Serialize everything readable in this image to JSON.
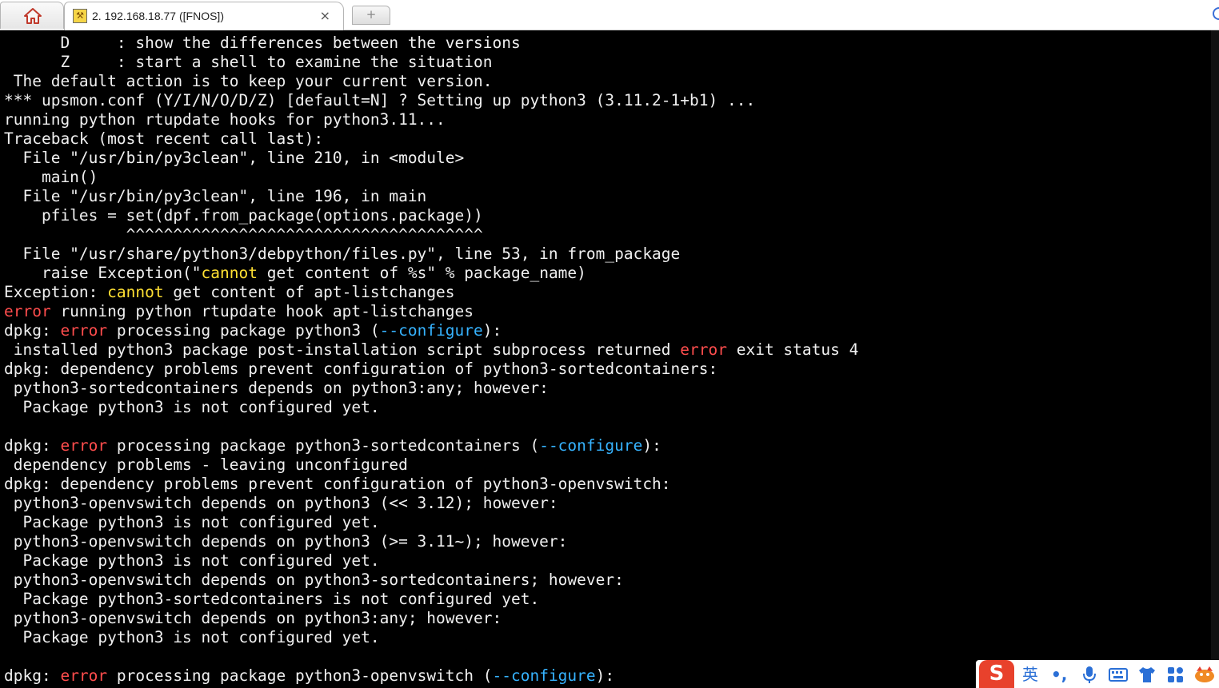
{
  "window": {
    "home_tab_icon": "home-icon",
    "session_tab": {
      "icon": "terminal-key-icon",
      "title": "2. 192.168.18.77 ([FNOS])",
      "close_glyph": "×"
    },
    "new_tab_glyph": "+"
  },
  "colors": {
    "background": "#000000",
    "text": "#f0f0f0",
    "error": "#ff4d4d",
    "configure": "#36b3ff",
    "cannot": "#ffe033"
  },
  "terminal": {
    "lines": [
      [
        {
          "t": "      D     : show the differences between the versions"
        }
      ],
      [
        {
          "t": "      Z     : start a shell to examine the situation"
        }
      ],
      [
        {
          "t": " The default action is to keep your current version."
        }
      ],
      [
        {
          "t": "*** upsmon.conf (Y/I/N/O/D/Z) [default=N] ? Setting up python3 (3.11.2-1+b1) ..."
        }
      ],
      [
        {
          "t": "running python rtupdate hooks for python3.11..."
        }
      ],
      [
        {
          "t": "Traceback (most recent call last):"
        }
      ],
      [
        {
          "t": "  File \"/usr/bin/py3clean\", line 210, in <module>"
        }
      ],
      [
        {
          "t": "    main()"
        }
      ],
      [
        {
          "t": "  File \"/usr/bin/py3clean\", line 196, in main"
        }
      ],
      [
        {
          "t": "    pfiles = set(dpf.from_package(options.package))"
        }
      ],
      [
        {
          "t": "             ^^^^^^^^^^^^^^^^^^^^^^^^^^^^^^^^^^^^^^"
        }
      ],
      [
        {
          "t": "  File \"/usr/share/python3/debpython/files.py\", line 53, in from_package"
        }
      ],
      [
        {
          "t": "    raise Exception(\""
        },
        {
          "t": "cannot",
          "c": "yel"
        },
        {
          "t": " get content of %s\" % package_name)"
        }
      ],
      [
        {
          "t": "Exception: "
        },
        {
          "t": "cannot",
          "c": "yel"
        },
        {
          "t": " get content of apt-listchanges"
        }
      ],
      [
        {
          "t": "error",
          "c": "err"
        },
        {
          "t": " running python rtupdate hook apt-listchanges"
        }
      ],
      [
        {
          "t": "dpkg: "
        },
        {
          "t": "error",
          "c": "err"
        },
        {
          "t": " processing package python3 ("
        },
        {
          "t": "--configure",
          "c": "cfg"
        },
        {
          "t": "):"
        }
      ],
      [
        {
          "t": " installed python3 package post-installation script subprocess returned "
        },
        {
          "t": "error",
          "c": "err"
        },
        {
          "t": " exit status 4"
        }
      ],
      [
        {
          "t": "dpkg: dependency problems prevent configuration of python3-sortedcontainers:"
        }
      ],
      [
        {
          "t": " python3-sortedcontainers depends on python3:any; however:"
        }
      ],
      [
        {
          "t": "  Package python3 is not configured yet."
        }
      ],
      [
        {
          "t": ""
        }
      ],
      [
        {
          "t": "dpkg: "
        },
        {
          "t": "error",
          "c": "err"
        },
        {
          "t": " processing package python3-sortedcontainers ("
        },
        {
          "t": "--configure",
          "c": "cfg"
        },
        {
          "t": "):"
        }
      ],
      [
        {
          "t": " dependency problems - leaving unconfigured"
        }
      ],
      [
        {
          "t": "dpkg: dependency problems prevent configuration of python3-openvswitch:"
        }
      ],
      [
        {
          "t": " python3-openvswitch depends on python3 (<< 3.12); however:"
        }
      ],
      [
        {
          "t": "  Package python3 is not configured yet."
        }
      ],
      [
        {
          "t": " python3-openvswitch depends on python3 (>= 3.11~); however:"
        }
      ],
      [
        {
          "t": "  Package python3 is not configured yet."
        }
      ],
      [
        {
          "t": " python3-openvswitch depends on python3-sortedcontainers; however:"
        }
      ],
      [
        {
          "t": "  Package python3-sortedcontainers is not configured yet."
        }
      ],
      [
        {
          "t": " python3-openvswitch depends on python3:any; however:"
        }
      ],
      [
        {
          "t": "  Package python3 is not configured yet."
        }
      ],
      [
        {
          "t": ""
        }
      ],
      [
        {
          "t": "dpkg: "
        },
        {
          "t": "error",
          "c": "err"
        },
        {
          "t": " processing package python3-openvswitch ("
        },
        {
          "t": "--configure",
          "c": "cfg"
        },
        {
          "t": "):"
        }
      ]
    ]
  },
  "ime_toolbar": {
    "logo": "S",
    "mode": "英",
    "punct": "•,",
    "icons": [
      "sogou-logo-icon",
      "microphone-icon",
      "keyboard-icon",
      "skin-shirt-icon",
      "toolbox-grid-icon",
      "mascot-icon"
    ]
  }
}
